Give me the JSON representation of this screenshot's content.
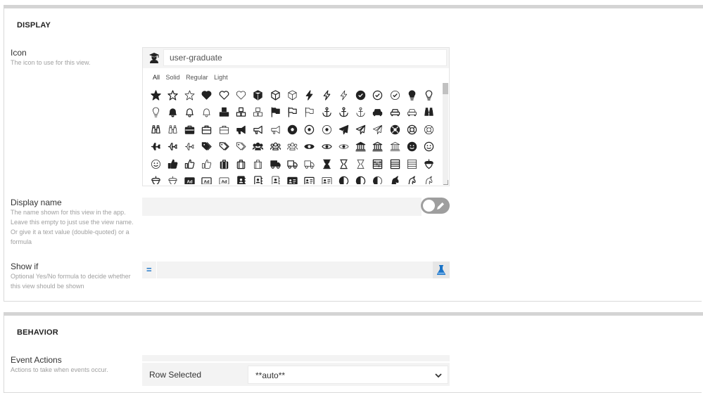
{
  "display": {
    "title": "DISPLAY",
    "icon": {
      "label": "Icon",
      "help": "The icon to use for this view.",
      "search_value": "user-graduate",
      "filters": [
        "All",
        "Solid",
        "Regular",
        "Light"
      ],
      "active_filter": "All"
    },
    "display_name": {
      "label": "Display name",
      "help": "The name shown for this view in the app. Leave this empty to just use the view name. Or give it a text value (double-quoted) or a formula",
      "value": ""
    },
    "show_if": {
      "label": "Show if",
      "help": "Optional Yes/No formula to decide whether this view should be shown",
      "prefix": "="
    }
  },
  "behavior": {
    "title": "BEHAVIOR",
    "event_actions": {
      "label": "Event Actions",
      "help": "Actions to take when events occur.",
      "row_label": "Row Selected",
      "row_value": "**auto**"
    }
  },
  "icon_grid": [
    [
      "star-icon",
      "star-icon",
      "star-icon",
      "heart-icon",
      "heart-icon",
      "heart-icon",
      "cube-icon",
      "cube-icon",
      "cube-icon",
      "bolt-icon",
      "bolt-icon",
      "bolt-icon",
      "check-circle-icon",
      "check-circle-icon",
      "check-circle-icon",
      "lightbulb-icon",
      "lightbulb-icon"
    ],
    [
      "lightbulb-icon",
      "bell-icon",
      "bell-icon",
      "bell-icon",
      "cubes-icon",
      "cubes-icon",
      "cubes-icon",
      "flag-icon",
      "flag-icon",
      "flag-icon",
      "anchor-icon",
      "anchor-icon",
      "anchor-icon",
      "car-icon",
      "car-icon",
      "car-icon",
      "binoculars-icon"
    ],
    [
      "binoculars-icon",
      "binoculars-icon",
      "briefcase-icon",
      "briefcase-icon",
      "briefcase-icon",
      "bullhorn-icon",
      "bullhorn-icon",
      "bullhorn-icon",
      "futbol-icon",
      "futbol-icon",
      "futbol-icon",
      "paper-plane-icon",
      "paper-plane-icon",
      "paper-plane-icon",
      "life-ring-icon",
      "life-ring-icon",
      "life-ring-icon"
    ],
    [
      "plane-icon",
      "plane-icon",
      "plane-icon",
      "tags-icon",
      "tags-icon",
      "tags-icon",
      "users-icon",
      "users-icon",
      "users-icon",
      "eye-icon",
      "eye-icon",
      "eye-icon",
      "university-icon",
      "university-icon",
      "university-icon",
      "smile-icon",
      "smile-icon"
    ],
    [
      "smile-icon",
      "thumbs-up-icon",
      "thumbs-up-icon",
      "thumbs-up-icon",
      "suitcase-icon",
      "suitcase-icon",
      "suitcase-icon",
      "truck-icon",
      "truck-icon",
      "truck-icon",
      "hourglass-icon",
      "hourglass-icon",
      "hourglass-icon",
      "abacus-icon",
      "abacus-icon",
      "abacus-icon",
      "acorn-icon"
    ],
    [
      "acorn-icon",
      "acorn-icon",
      "ad-icon",
      "ad-icon",
      "ad-icon",
      "address-book-icon",
      "address-book-icon",
      "address-book-icon",
      "address-card-icon",
      "address-card-icon",
      "address-card-icon",
      "adjust-icon",
      "adjust-icon",
      "adjust-icon",
      "alicorn-icon",
      "alicorn-icon",
      "alicorn-icon"
    ]
  ],
  "icon_grid_styles": [
    [
      "solid",
      "regular",
      "light",
      "solid",
      "regular",
      "light",
      "solid",
      "regular",
      "light",
      "solid",
      "regular",
      "light",
      "solid",
      "regular",
      "light",
      "solid",
      "regular"
    ],
    [
      "light",
      "solid",
      "regular",
      "light",
      "solid",
      "regular",
      "light",
      "solid",
      "regular",
      "light",
      "solid",
      "regular",
      "light",
      "solid",
      "regular",
      "light",
      "solid"
    ],
    [
      "regular",
      "light",
      "solid",
      "regular",
      "light",
      "solid",
      "regular",
      "light",
      "solid",
      "regular",
      "light",
      "solid",
      "regular",
      "light",
      "solid",
      "regular",
      "light"
    ],
    [
      "solid",
      "regular",
      "light",
      "solid",
      "regular",
      "light",
      "solid",
      "regular",
      "light",
      "solid",
      "regular",
      "light",
      "solid",
      "regular",
      "light",
      "solid",
      "regular"
    ],
    [
      "light",
      "solid",
      "regular",
      "light",
      "solid",
      "regular",
      "light",
      "solid",
      "regular",
      "light",
      "solid",
      "regular",
      "light",
      "solid",
      "regular",
      "light",
      "solid"
    ],
    [
      "regular",
      "light",
      "solid",
      "regular",
      "light",
      "solid",
      "regular",
      "light",
      "solid",
      "regular",
      "light",
      "solid",
      "regular",
      "light",
      "solid",
      "regular",
      "light"
    ]
  ],
  "colors": {
    "accent": "#1a73c7",
    "icon": "#222222",
    "toggle": "#9e9e9e"
  }
}
